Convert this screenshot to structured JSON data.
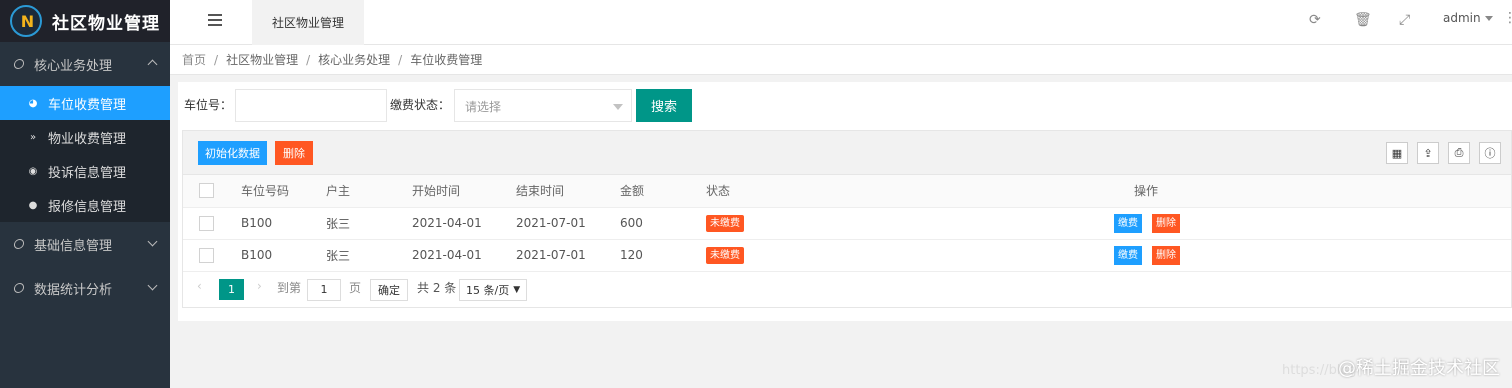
{
  "app": {
    "title": "社区物业管理",
    "logo_text": "N"
  },
  "sidebar": {
    "groups": [
      {
        "label": "核心业务处理",
        "expanded": true,
        "items": [
          {
            "label": "车位收费管理",
            "icon": "gauge-icon",
            "active": true
          },
          {
            "label": "物业收费管理",
            "icon": "chevron-double-down-icon",
            "active": false
          },
          {
            "label": "投诉信息管理",
            "icon": "target-icon",
            "active": false
          },
          {
            "label": "报修信息管理",
            "icon": "circle-up-icon",
            "active": false
          }
        ]
      },
      {
        "label": "基础信息管理",
        "expanded": false
      },
      {
        "label": "数据统计分析",
        "expanded": false
      }
    ]
  },
  "header": {
    "tab_label": "社区物业管理",
    "user": "admin",
    "icons": [
      "refresh-icon",
      "trash-icon",
      "fullscreen-icon",
      "more-icon"
    ]
  },
  "breadcrumb": [
    "首页",
    "社区物业管理",
    "核心业务处理",
    "车位收费管理"
  ],
  "search": {
    "plate_label": "车位号：",
    "plate_value": "",
    "status_label": "缴费状态：",
    "status_placeholder": "请选择",
    "search_button": "搜索"
  },
  "toolbar": {
    "init_button": "初始化数据",
    "delete_button": "删除",
    "icons": [
      "columns-icon",
      "export-icon",
      "print-icon",
      "info-icon"
    ]
  },
  "table": {
    "columns": [
      "车位号码",
      "户主",
      "开始时间",
      "结束时间",
      "金额",
      "状态",
      "操作"
    ],
    "rows": [
      {
        "plate": "B100",
        "owner": "张三",
        "start": "2021-04-01",
        "end": "2021-07-01",
        "amount": "600",
        "status": "未缴费",
        "pay": "缴费",
        "del": "删除"
      },
      {
        "plate": "B100",
        "owner": "张三",
        "start": "2021-04-01",
        "end": "2021-07-01",
        "amount": "120",
        "status": "未缴费",
        "pay": "缴费",
        "del": "删除"
      }
    ]
  },
  "pager": {
    "current": "1",
    "goto_label": "到第",
    "goto_value": "1",
    "page_unit": "页",
    "confirm": "确定",
    "total": "共 2 条",
    "page_size": "15 条/页"
  },
  "watermark": {
    "text": "@稀土掘金技术社区",
    "url": "https://blog"
  },
  "colors": {
    "primary": "#009688",
    "active": "#1e9fff",
    "danger": "#ff5722",
    "sidebar": "#28333e"
  }
}
